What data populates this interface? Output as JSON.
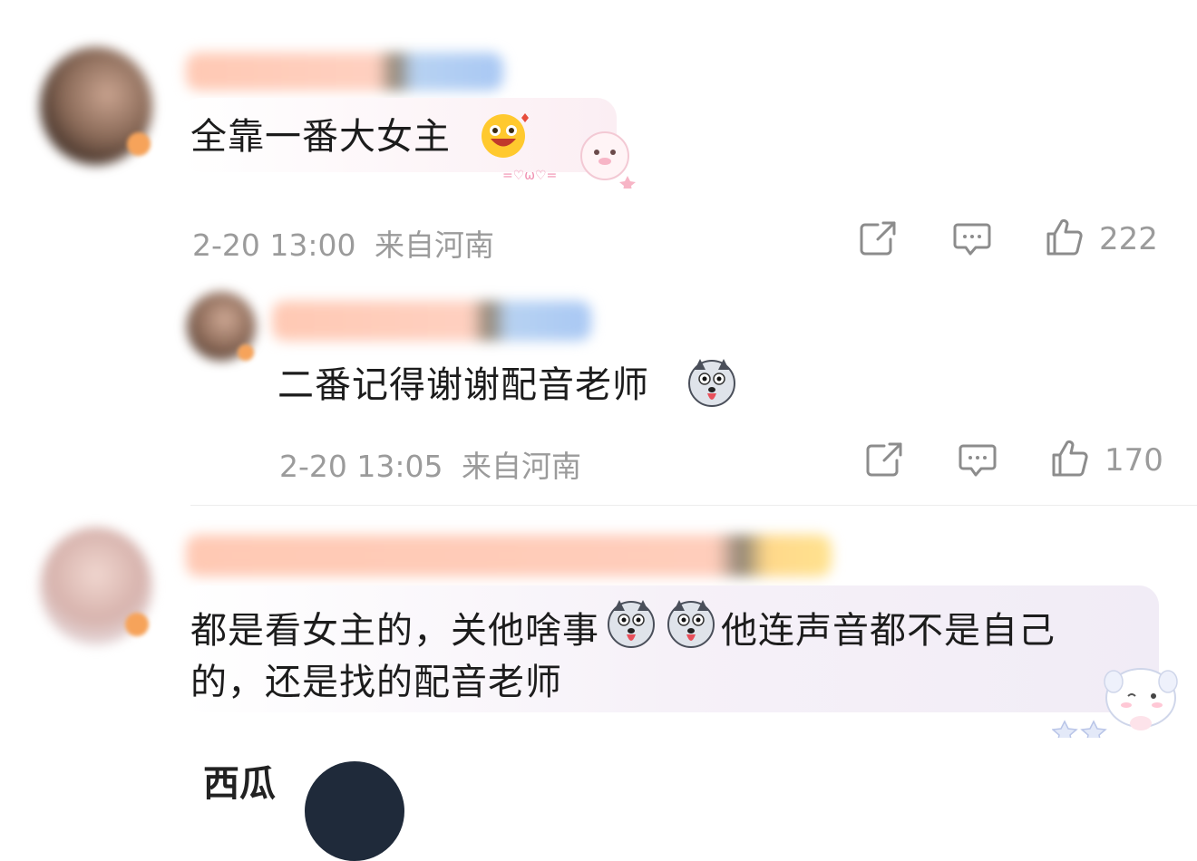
{
  "comments": [
    {
      "text": "全靠一番大女主",
      "time": "2-20 13:00",
      "location": "来自河南",
      "likes": "222"
    },
    {
      "text": "二番记得谢谢配音老师",
      "time": "2-20 13:05",
      "location": "来自河南",
      "likes": "170"
    },
    {
      "text_part1": "都是看女主的，关他啥事",
      "text_part2": "他连声音都不是自己",
      "text_line2": "的，还是找的配音老师"
    }
  ],
  "partial_username": "西瓜",
  "colors": {
    "meta_gray": "#9b9b9b",
    "bubble_pink": "#fbeef3",
    "bubble_lilac": "#f3eff7"
  },
  "icons": [
    "share-icon",
    "comment-icon",
    "like-icon"
  ]
}
